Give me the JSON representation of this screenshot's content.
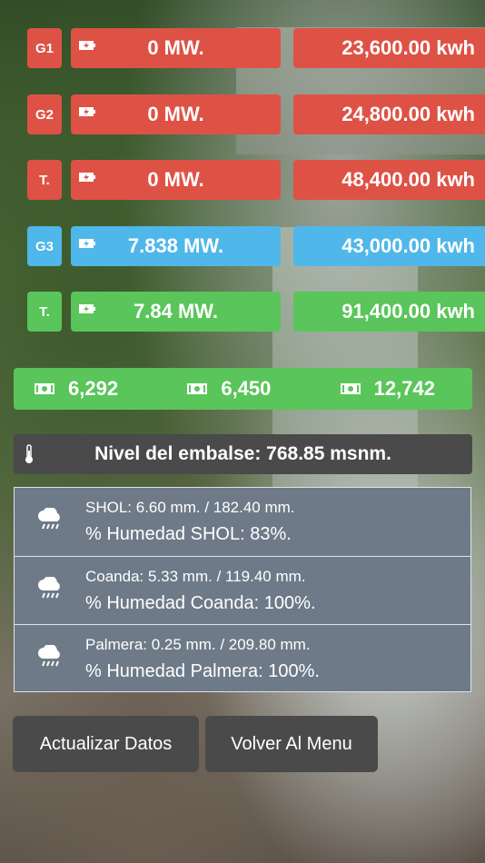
{
  "rows": [
    {
      "tag": "G1",
      "mw": "0 MW.",
      "kwh": "23,600.00 kwh",
      "color": "#de5246"
    },
    {
      "tag": "G2",
      "mw": "0 MW.",
      "kwh": "24,800.00 kwh",
      "color": "#de5246"
    },
    {
      "tag": "T.",
      "mw": "0 MW.",
      "kwh": "48,400.00 kwh",
      "color": "#de5246"
    },
    {
      "tag": "G3",
      "mw": "7.838 MW.",
      "kwh": "43,000.00 kwh",
      "color": "#4fb7ea"
    },
    {
      "tag": "T.",
      "mw": "7.84 MW.",
      "kwh": "91,400.00 kwh",
      "color": "#5ac55a"
    }
  ],
  "money": [
    "6,292",
    "6,450",
    "12,742"
  ],
  "level": {
    "text": "Nivel del embalse: 768.85 msnm."
  },
  "weather": [
    {
      "line1": "SHOL: 6.60 mm. / 182.40 mm.",
      "line2": "% Humedad SHOL: 83%."
    },
    {
      "line1": "Coanda: 5.33 mm. / 119.40 mm.",
      "line2": "% Humedad Coanda: 100%."
    },
    {
      "line1": "Palmera: 0.25 mm. / 209.80 mm.",
      "line2": "% Humedad Palmera: 100%."
    }
  ],
  "buttons": {
    "update": "Actualizar Datos",
    "menu": "Volver Al Menu"
  },
  "icons": {
    "battery": "battery-charging-icon",
    "money": "money-bill-icon",
    "thermo": "thermometer-icon",
    "weather": "rain-cloud-icon"
  }
}
